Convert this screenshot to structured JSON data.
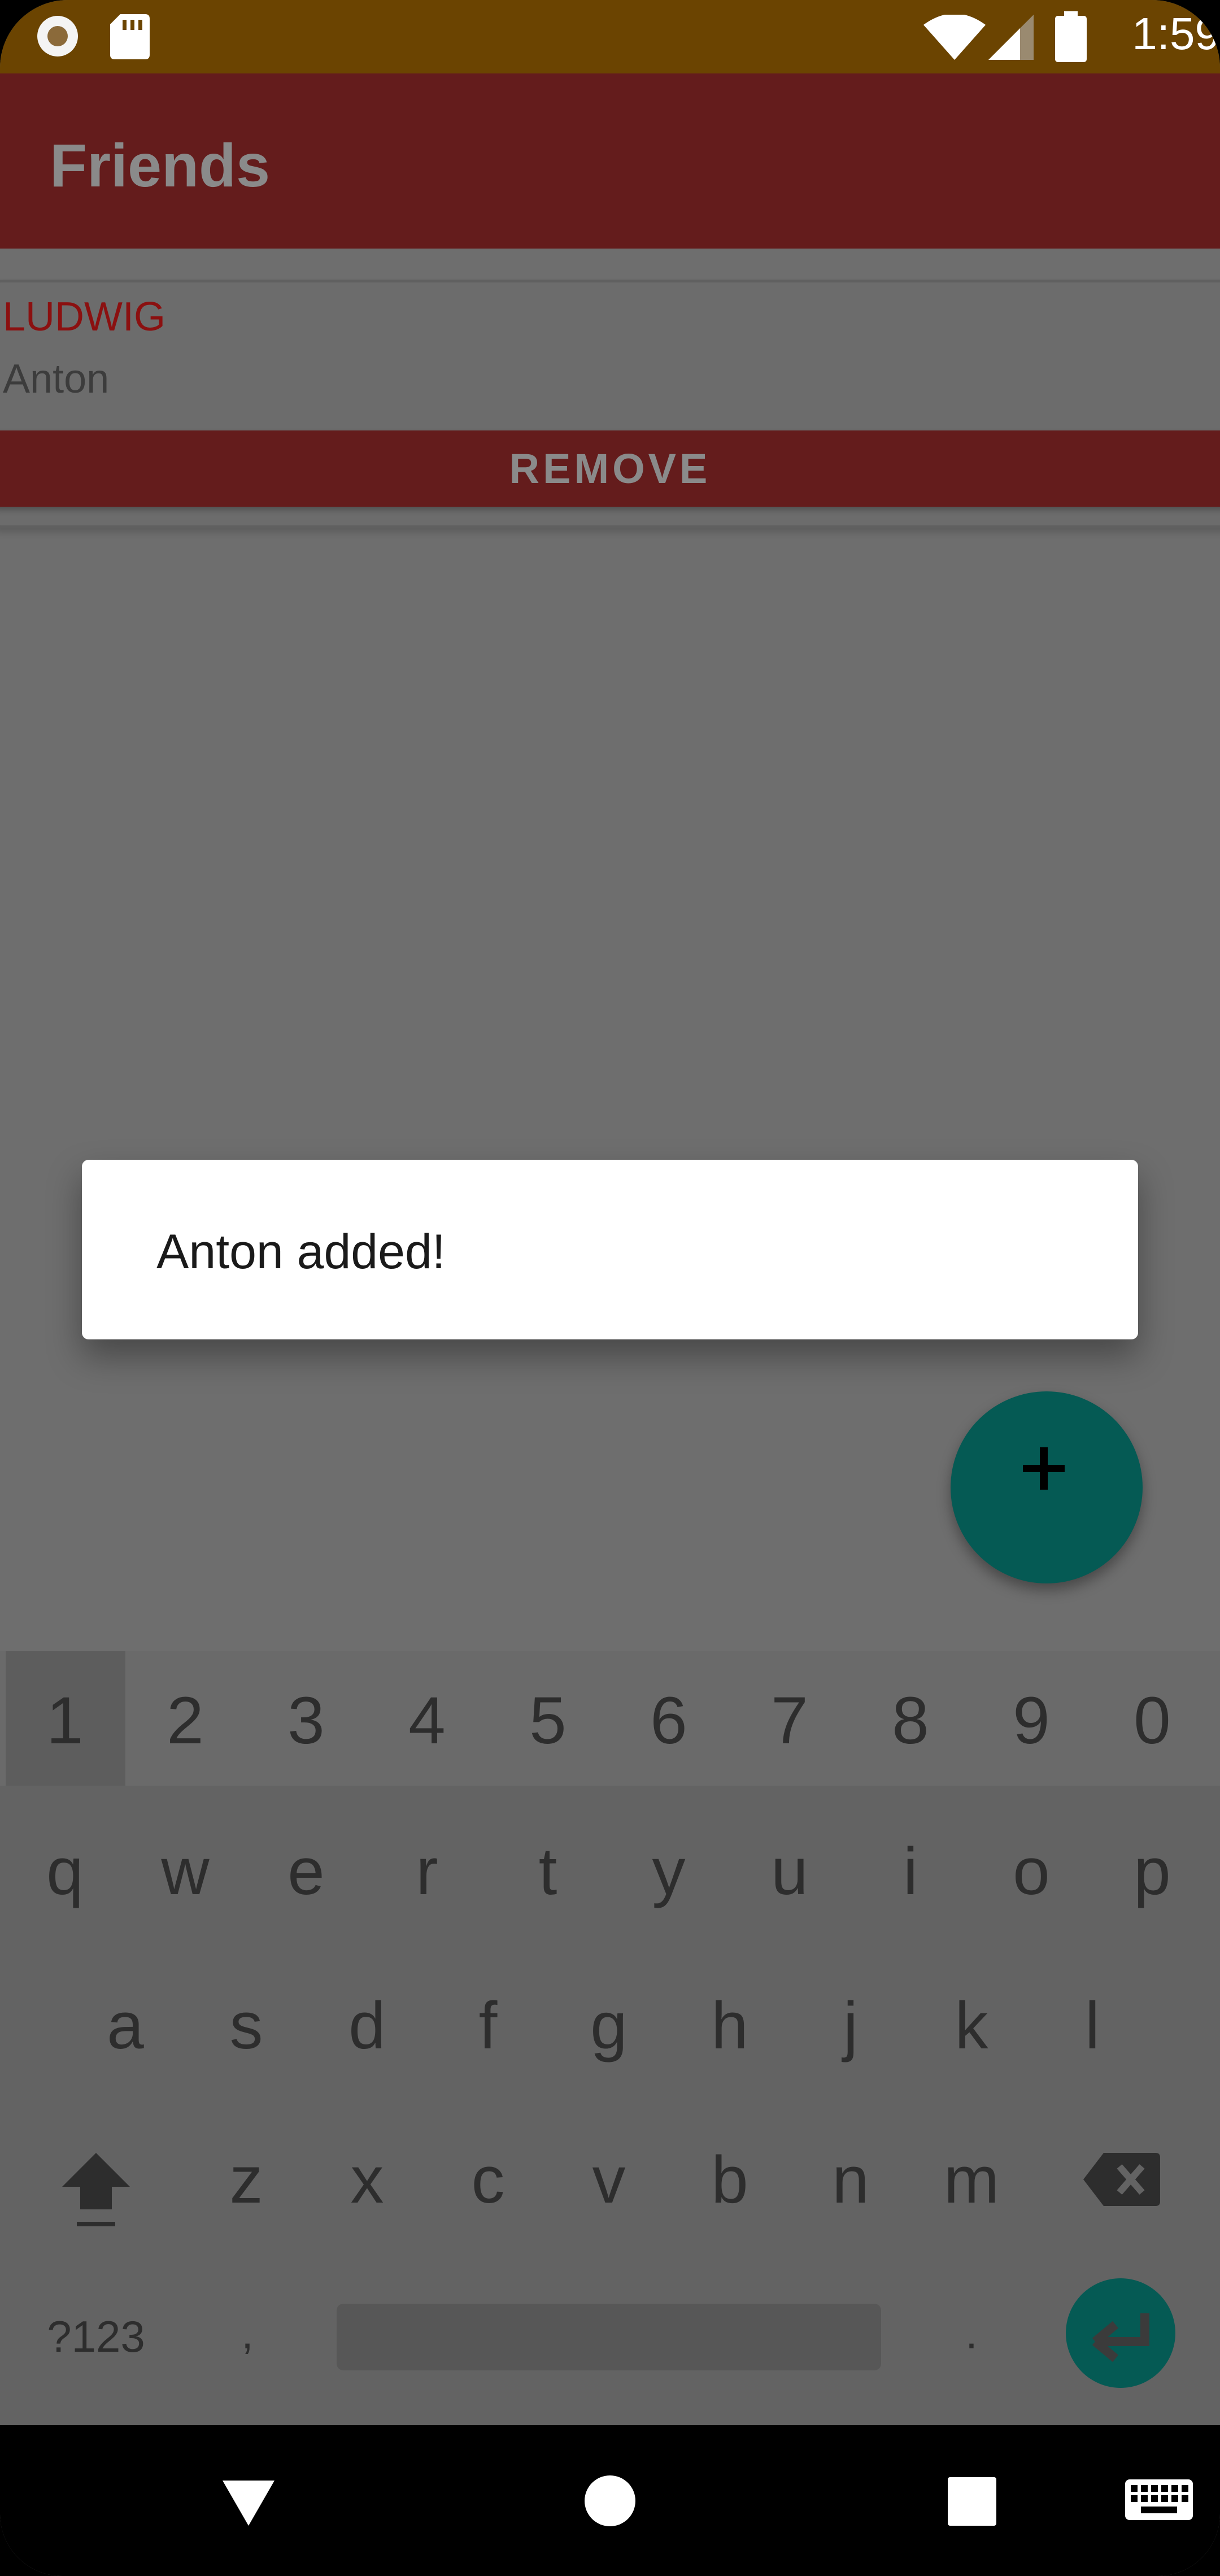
{
  "status_bar": {
    "time": "1:59",
    "icons": [
      "notification-ring-icon",
      "sd-card-icon",
      "wifi-icon",
      "signal-icon",
      "battery-icon"
    ]
  },
  "app_bar": {
    "title": "Friends"
  },
  "friend_card": {
    "name": "LUDWIG",
    "subtitle": "Anton",
    "remove_label": "REMOVE"
  },
  "dialog": {
    "message": "Anton added!"
  },
  "fab": {
    "icon": "plus-icon"
  },
  "keyboard": {
    "number_row": [
      "1",
      "2",
      "3",
      "4",
      "5",
      "6",
      "7",
      "8",
      "9",
      "0"
    ],
    "row1": [
      "q",
      "w",
      "e",
      "r",
      "t",
      "y",
      "u",
      "i",
      "o",
      "p"
    ],
    "row2": [
      "a",
      "s",
      "d",
      "f",
      "g",
      "h",
      "j",
      "k",
      "l"
    ],
    "row3": [
      "z",
      "x",
      "c",
      "v",
      "b",
      "n",
      "m"
    ],
    "symbols_label": "?123",
    "comma": ",",
    "period": "."
  },
  "nav_bar": {
    "icons": [
      "back-icon",
      "home-icon",
      "recents-icon",
      "keyboard-icon"
    ]
  },
  "colors": {
    "status_bar": "#6b4401",
    "app_bar": "#641c1c",
    "accent_teal": "#055a54",
    "card_name": "#8b1010",
    "scrim": "#6e6e6e"
  }
}
